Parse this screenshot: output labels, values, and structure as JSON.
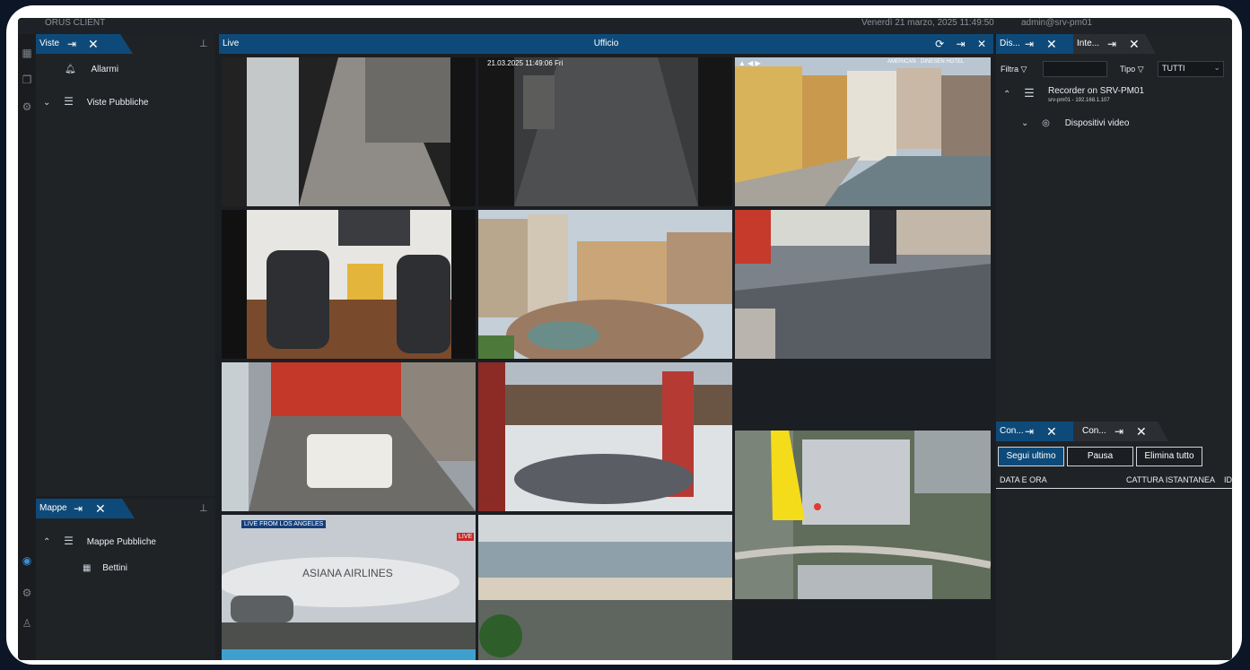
{
  "topbar": {
    "app_title": "ORUS CLIENT",
    "datetime": "Venerdì 21 marzo, 2025 11:49:50",
    "user": "admin@srv-pm01"
  },
  "left_panel": {
    "tab_label": "Viste",
    "items": [
      {
        "label": "Allarmi"
      },
      {
        "label": "Viste Pubbliche"
      }
    ]
  },
  "maps_panel": {
    "tab_label": "Mappe",
    "items": [
      {
        "label": "Mappe Pubbliche"
      },
      {
        "label": "Bettini"
      }
    ]
  },
  "live": {
    "tab_label": "Live",
    "view_title": "Ufficio",
    "cells": [
      {
        "overlay": ""
      },
      {
        "overlay": "21.03.2025 11:49:06 Fri"
      },
      {
        "overlay": "AMERICAN · DINESEN HOTEL"
      },
      {
        "overlay": ""
      },
      {
        "overlay": ""
      },
      {
        "overlay": ""
      },
      {
        "overlay": ""
      },
      {
        "overlay": ""
      },
      {
        "overlay": ""
      },
      {
        "overlay": "LIVE FROM LOS ANGELES"
      },
      {
        "overlay": ""
      },
      {
        "overlay": ""
      }
    ],
    "plane_text": "ASIANA AIRLINES"
  },
  "devices_panel": {
    "tab1_label": "Dis...",
    "tab2_label": "Inte...",
    "filter_label": "Filtra",
    "type_label": "Tipo",
    "type_value": "TUTTI",
    "recorder_name": "Recorder on SRV-PM01",
    "recorder_addr": "srv-pm01 - 192.168.1.107",
    "video_devices": "Dispositivi video"
  },
  "events_panel": {
    "tab1_label": "Con...",
    "tab2_label": "Con...",
    "btn_follow": "Segui ultimo",
    "btn_pause": "Pausa",
    "btn_clear": "Elimina tutto",
    "col_date": "DATA E ORA",
    "col_snapshot": "CATTURA ISTANTANEA",
    "col_id": "ID"
  },
  "colors": {
    "accent": "#0e4a79",
    "bg": "#1b1e22",
    "panel": "#202326"
  }
}
